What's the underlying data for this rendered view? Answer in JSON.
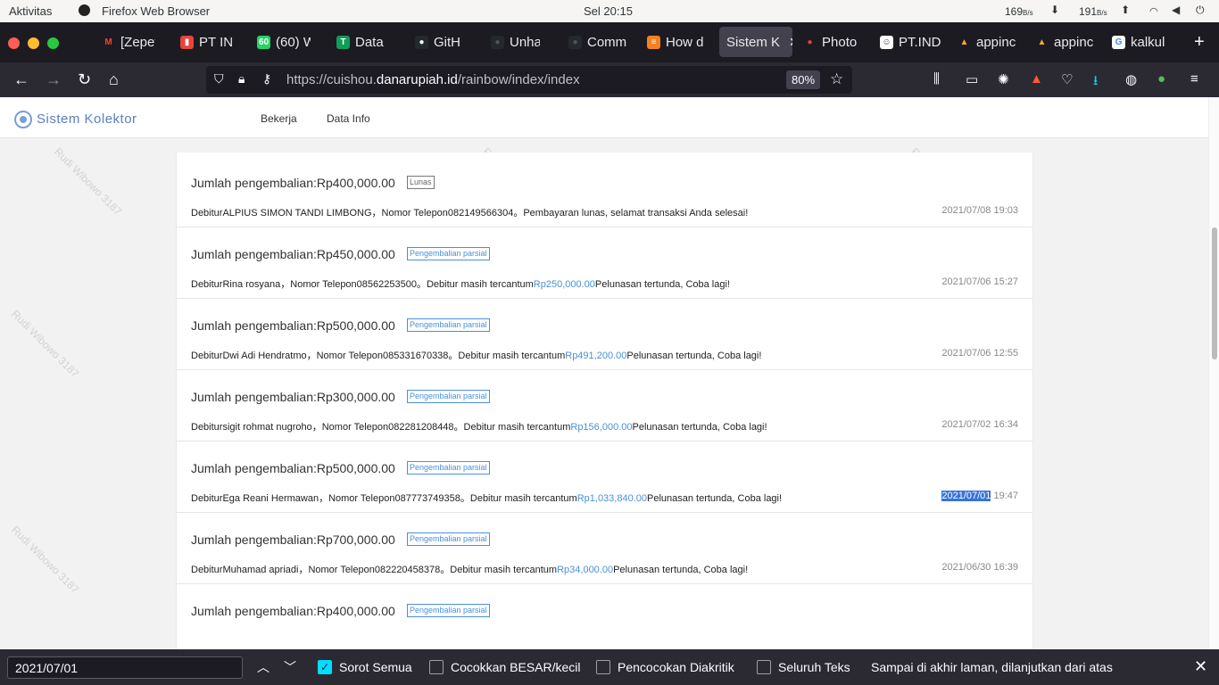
{
  "system_bar": {
    "activities": "Aktivitas",
    "app_name": "Firefox Web Browser",
    "clock": "Sel 20:15",
    "net_down": "169",
    "net_down_unit": "B/s",
    "net_up": "191",
    "net_up_unit": "B/s"
  },
  "tabs": [
    {
      "label": "[Zepet",
      "icon_color": "#1c1b22",
      "icon_glyph": "M",
      "glyph_color": "#ea4335"
    },
    {
      "label": "PT IND",
      "icon_color": "#e8453c",
      "icon_glyph": "▮",
      "glyph_color": "#fff"
    },
    {
      "label": "(60) W",
      "icon_color": "#25d366",
      "icon_glyph": "60",
      "glyph_color": "#fff"
    },
    {
      "label": "Data L",
      "icon_color": "#0f9d58",
      "icon_glyph": "T",
      "glyph_color": "#fff"
    },
    {
      "label": "GitHub",
      "icon_color": "#24292e",
      "icon_glyph": "●",
      "glyph_color": "#fff"
    },
    {
      "label": "Unhan",
      "icon_color": "#24292e",
      "icon_glyph": "●",
      "glyph_color": "#555"
    },
    {
      "label": "Comm",
      "icon_color": "#24292e",
      "icon_glyph": "●",
      "glyph_color": "#555"
    },
    {
      "label": "How d",
      "icon_color": "#f48024",
      "icon_glyph": "≡",
      "glyph_color": "#fff"
    },
    {
      "label": "Sistem K",
      "icon_color": "",
      "icon_glyph": "",
      "glyph_color": "",
      "active": true
    },
    {
      "label": "Photo",
      "icon_color": "#1c1b22",
      "icon_glyph": "●",
      "glyph_color": "#ea4335"
    },
    {
      "label": "PT.IND",
      "icon_color": "#fff",
      "icon_glyph": "☺",
      "glyph_color": "#333"
    },
    {
      "label": "appinc",
      "icon_color": "#1c1b22",
      "icon_glyph": "▲",
      "glyph_color": "#f4a933"
    },
    {
      "label": "appinc",
      "icon_color": "#1c1b22",
      "icon_glyph": "▲",
      "glyph_color": "#f4a933"
    },
    {
      "label": "kalkula",
      "icon_color": "#fff",
      "icon_glyph": "G",
      "glyph_color": "#4285f4"
    }
  ],
  "url": {
    "prefix": "https://cuishou.",
    "domain": "danarupiah.id",
    "path": "/rainbow/index/index",
    "zoom": "80%"
  },
  "site": {
    "brand": "Sistem Kolektor",
    "menu": [
      "Bekerja",
      "Data Info"
    ],
    "watermark": "Rudi Wibowo 3187"
  },
  "entries": [
    {
      "amount": "Jumlah pengembalian:Rp400,000.00",
      "badge": "Lunas",
      "status": "lunas",
      "desc_pre": "DebiturALPIUS SIMON TANDI LIMBONG，Nomor Telepon082149566304。Pembayaran lunas, selamat transaksi Anda selesai!",
      "remaining": "",
      "desc_post": "",
      "date": "2021/07/08",
      "time": "19:03",
      "highlight": false
    },
    {
      "amount": "Jumlah pengembalian:Rp450,000.00",
      "badge": "Pengembalian parsial",
      "status": "parsial",
      "desc_pre": "DebiturRina rosyana，Nomor Telepon08562253500。Debitur masih tercantum",
      "remaining": "Rp250,000.00",
      "desc_post": "Pelunasan tertunda, Coba lagi!",
      "date": "2021/07/06",
      "time": "15:27",
      "highlight": false
    },
    {
      "amount": "Jumlah pengembalian:Rp500,000.00",
      "badge": "Pengembalian parsial",
      "status": "parsial",
      "desc_pre": "DebiturDwi Adi Hendratmo，Nomor Telepon085331670338。Debitur masih tercantum",
      "remaining": "Rp491,200.00",
      "desc_post": "Pelunasan tertunda, Coba lagi!",
      "date": "2021/07/06",
      "time": "12:55",
      "highlight": false
    },
    {
      "amount": "Jumlah pengembalian:Rp300,000.00",
      "badge": "Pengembalian parsial",
      "status": "parsial",
      "desc_pre": "Debitursigit rohmat nugroho，Nomor Telepon082281208448。Debitur masih tercantum",
      "remaining": "Rp156,000.00",
      "desc_post": "Pelunasan tertunda, Coba lagi!",
      "date": "2021/07/02",
      "time": "16:34",
      "highlight": false
    },
    {
      "amount": "Jumlah pengembalian:Rp500,000.00",
      "badge": "Pengembalian parsial",
      "status": "parsial",
      "desc_pre": "DebiturEga Reani Hermawan，Nomor Telepon087773749358。Debitur masih tercantum",
      "remaining": "Rp1,033,840.00",
      "desc_post": "Pelunasan tertunda, Coba lagi!",
      "date": "2021/07/01",
      "time": "19:47",
      "highlight": true
    },
    {
      "amount": "Jumlah pengembalian:Rp700,000.00",
      "badge": "Pengembalian parsial",
      "status": "parsial",
      "desc_pre": "DebiturMuhamad apriadi，Nomor Telepon082220458378。Debitur masih tercantum",
      "remaining": "Rp34,000.00",
      "desc_post": "Pelunasan tertunda, Coba lagi!",
      "date": "2021/06/30",
      "time": "16:39",
      "highlight": false
    },
    {
      "amount": "Jumlah pengembalian:Rp400,000.00",
      "badge": "Pengembalian parsial",
      "status": "parsial",
      "desc_pre": "",
      "remaining": "",
      "desc_post": "",
      "date": "",
      "time": "",
      "highlight": false
    }
  ],
  "findbar": {
    "query": "2021/07/01",
    "highlight_all": "Sorot Semua",
    "match_case": "Cocokkan BESAR/kecil",
    "diacritics": "Pencocokan Diakritik",
    "whole_words": "Seluruh Teks",
    "status": "Sampai di akhir laman, dilanjutkan dari atas",
    "highlight_all_checked": true
  }
}
